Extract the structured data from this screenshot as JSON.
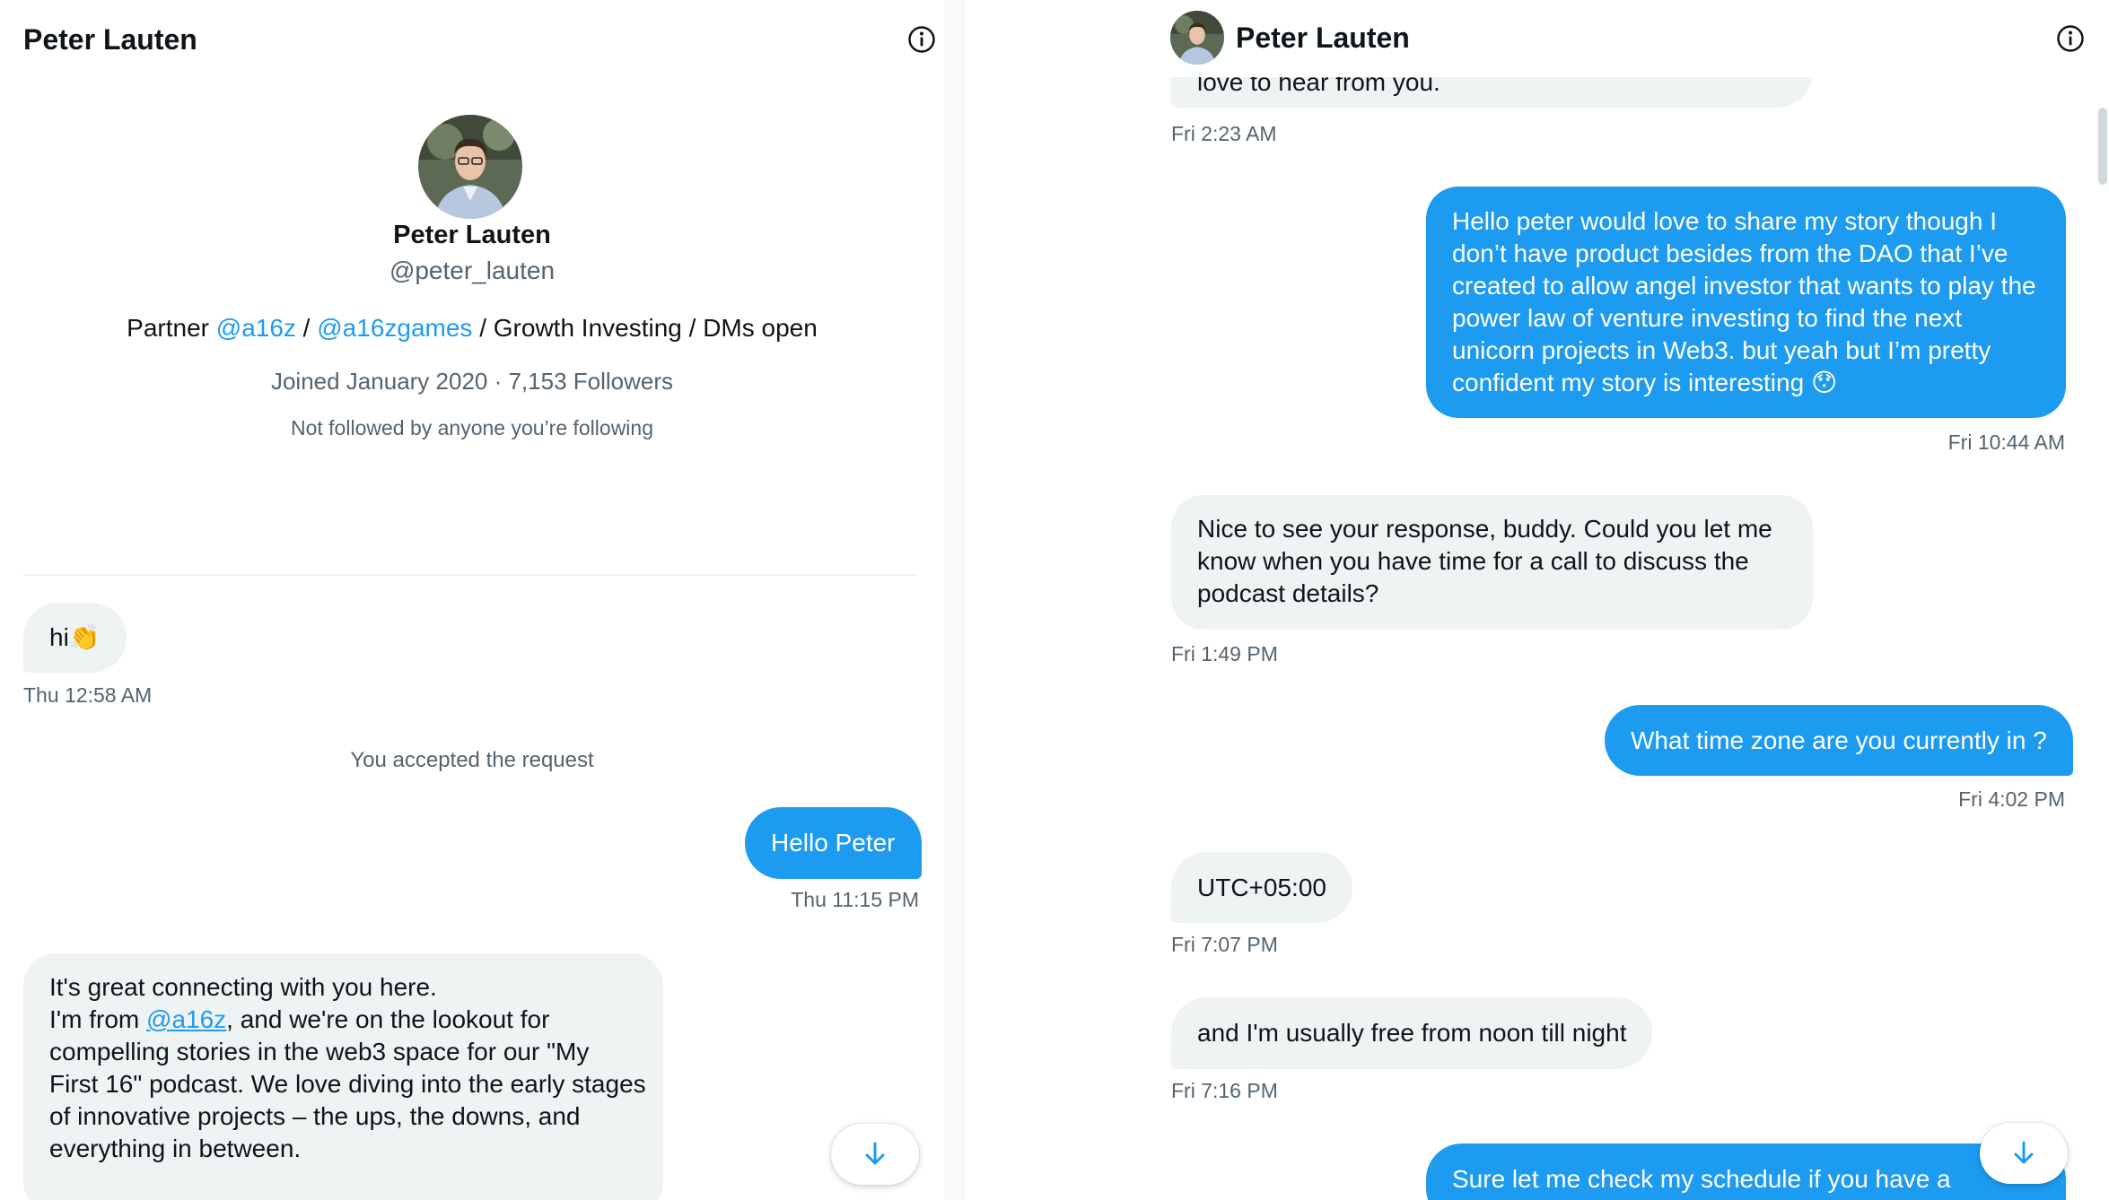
{
  "left": {
    "header": {
      "title": "Peter Lauten"
    },
    "profile": {
      "name": "Peter Lauten",
      "handle": "@peter_lauten",
      "bio": {
        "prefix": "Partner ",
        "mention1": "@a16z",
        "sep": " / ",
        "mention2": "@a16zgames",
        "suffix": " / Growth Investing / DMs open"
      },
      "stats": "Joined January 2020 · 7,153 Followers",
      "note": "Not followed by anyone you’re following"
    },
    "messages": [
      {
        "text": "hi👏",
        "time": "Thu 12:58 AM"
      }
    ],
    "system_note": "You accepted the request",
    "sent": {
      "text": "Hello Peter",
      "time": "Thu 11:15 PM"
    },
    "long_message": {
      "line1": "It's great connecting with you here.",
      "line2_prefix": "I'm from ",
      "line2_link": "@a16z",
      "line2_suffix": ", and we're on the lookout for",
      "line3": "compelling stories in the web3 space for our \"My",
      "line4": "First 16\" podcast. We love diving into the early stages",
      "line5": "of innovative projects – the ups, the downs, and",
      "line6": "everything in between."
    }
  },
  "right": {
    "header": {
      "title": "Peter Lauten"
    },
    "partial_top": {
      "text": "love to hear from you.",
      "time": "Fri 2:23 AM"
    },
    "msg1": {
      "lines": [
        "Hello peter would love to share my story though I",
        "don’t have product besides from the DAO that I’ve",
        "created to allow angel investor that wants to play the",
        "power law of venture investing to find the next",
        "unicorn projects in Web3. but yeah but I’m pretty",
        "confident my story is interesting 😯"
      ],
      "time": "Fri 10:44 AM"
    },
    "msg2": {
      "lines": [
        "Nice to see your response, buddy. Could you let me",
        "know when you have time for a call to discuss the",
        "podcast details?"
      ],
      "time": "Fri 1:49 PM"
    },
    "msg3": {
      "text": "What time zone are you currently in ?",
      "time": "Fri 4:02 PM"
    },
    "msg4": {
      "text": "UTC+05:00",
      "time": "Fri 7:07 PM"
    },
    "msg5": {
      "text": "and I'm usually free from noon till night",
      "time": "Fri 7:16 PM"
    },
    "msg6": {
      "text": "Sure let me check my schedule if you have a"
    }
  },
  "icons": {
    "info": "info-icon",
    "scroll_down": "arrow-down-icon"
  },
  "colors": {
    "accent": "#1d9bf0",
    "incoming_bubble": "#eff3f4",
    "muted_text": "#536471"
  }
}
